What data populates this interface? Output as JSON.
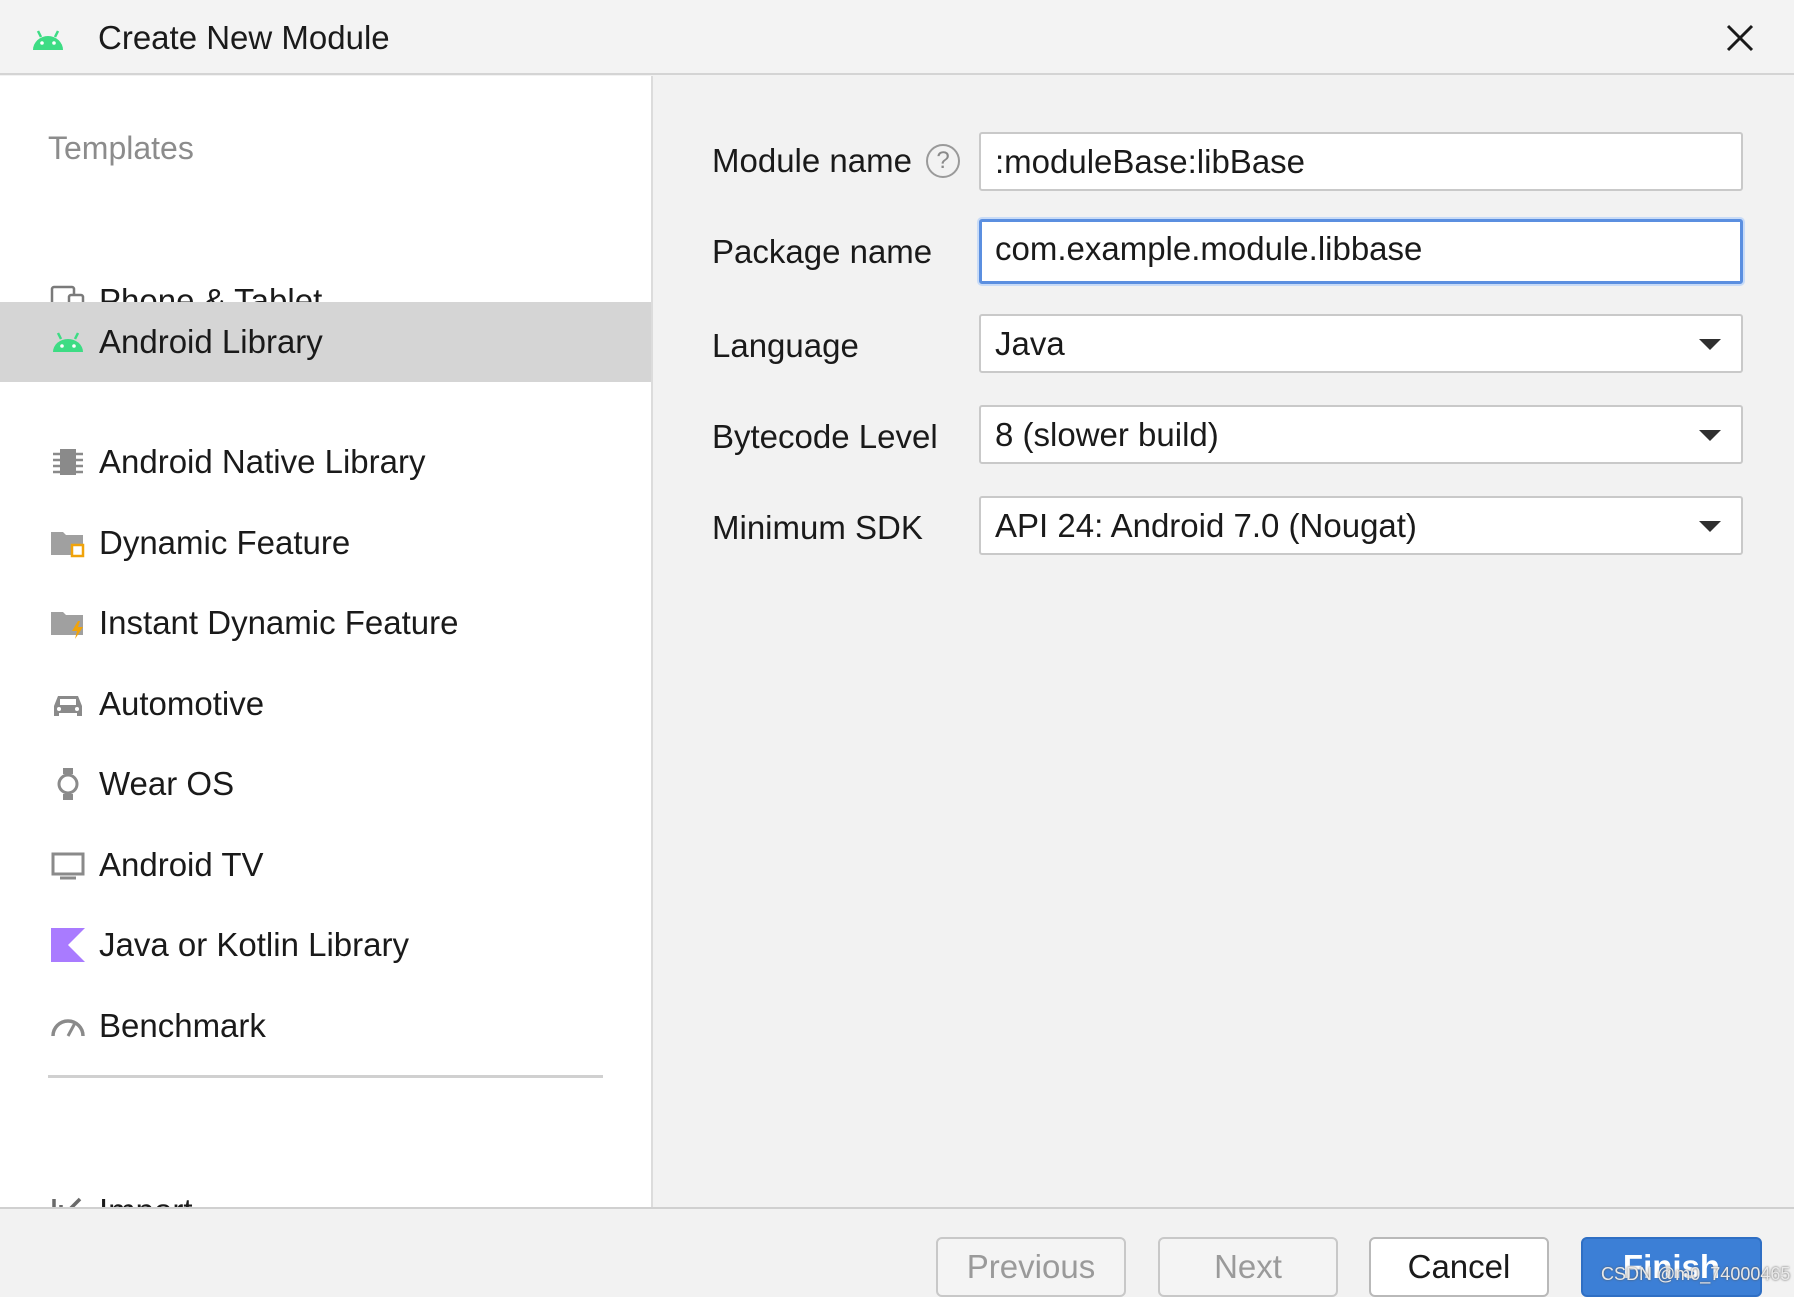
{
  "window": {
    "title": "Create New Module",
    "icon": "android-icon",
    "close_icon": "close-icon"
  },
  "sidebar": {
    "heading": "Templates",
    "items": [
      {
        "label": "Phone & Tablet",
        "icon": "phone-tablet-icon",
        "selected": false
      },
      {
        "label": "Android Library",
        "icon": "android-icon",
        "selected": true
      },
      {
        "label": "Android Native Library",
        "icon": "native-chip-icon",
        "selected": false
      },
      {
        "label": "Dynamic Feature",
        "icon": "dynamic-feature-folder-icon",
        "selected": false
      },
      {
        "label": "Instant Dynamic Feature",
        "icon": "instant-feature-folder-icon",
        "selected": false
      },
      {
        "label": "Automotive",
        "icon": "car-icon",
        "selected": false
      },
      {
        "label": "Wear OS",
        "icon": "watch-icon",
        "selected": false
      },
      {
        "label": "Android TV",
        "icon": "tv-icon",
        "selected": false
      },
      {
        "label": "Java or Kotlin Library",
        "icon": "kotlin-icon",
        "selected": false
      },
      {
        "label": "Benchmark",
        "icon": "gauge-icon",
        "selected": false
      }
    ],
    "import_label": "Import..."
  },
  "form": {
    "module_name_label": "Module name",
    "module_name_value": ":moduleBase:libBase",
    "help_glyph": "?",
    "package_name_label": "Package name",
    "package_name_value": "com.example.module.libbase",
    "language_label": "Language",
    "language_value": "Java",
    "bytecode_label": "Bytecode Level",
    "bytecode_value": "8 (slower build)",
    "min_sdk_label": "Minimum SDK",
    "min_sdk_value": "API 24: Android 7.0 (Nougat)"
  },
  "footer": {
    "previous_label": "Previous",
    "next_label": "Next",
    "cancel_label": "Cancel",
    "finish_label": "Finish",
    "watermark": "CSDN @m0_74000465"
  },
  "colors": {
    "android_green": "#3ddc84",
    "selection_bg": "#d5d5d5",
    "focus_border": "#5b8fe0",
    "primary_button": "#3c7fd6",
    "kotlin_purple": "#a97bff"
  }
}
